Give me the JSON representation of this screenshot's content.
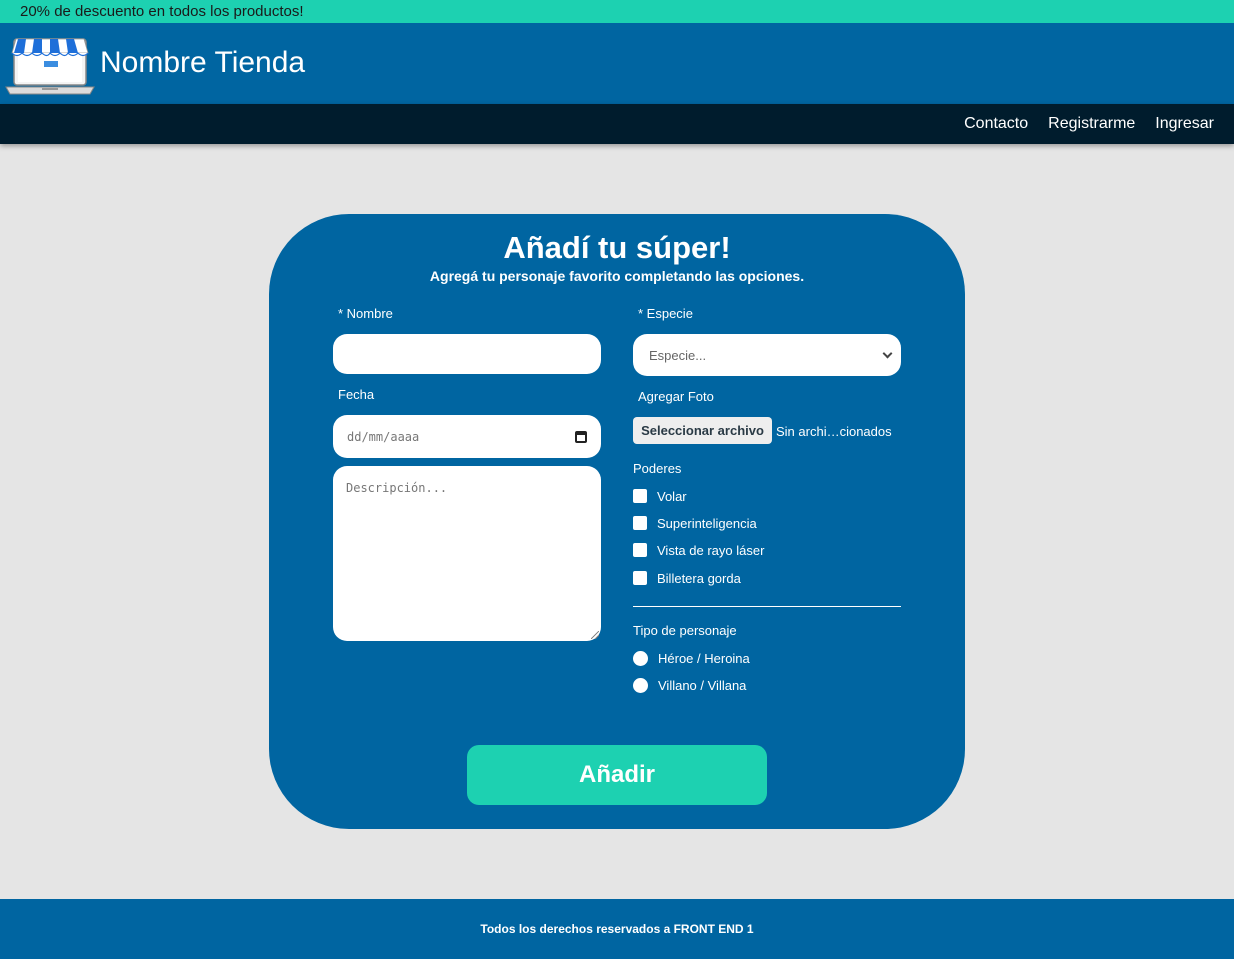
{
  "promo": {
    "text": "20% de descuento en todos los productos!"
  },
  "header": {
    "store_name": "Nombre Tienda",
    "logo_icon": "storefront-laptop-icon"
  },
  "nav": {
    "items": [
      "Contacto",
      "Registrarme",
      "Ingresar"
    ]
  },
  "form": {
    "title": "Añadí tu súper!",
    "subtitle": "Agregá tu personaje favorito completando las opciones.",
    "name_label": "* Nombre",
    "name_value": "",
    "date_label": "Fecha",
    "date_placeholder": "dd/mm/aaaa",
    "description_placeholder": "Descripción...",
    "species_label": "* Especie",
    "species_selected": "Especie...",
    "photo_label": "Agregar Foto",
    "file_button": "Seleccionar archivo",
    "file_status": "Sin archi…cionados",
    "powers_label": "Poderes",
    "powers": [
      "Volar",
      "Superinteligencia",
      "Vista de rayo láser",
      "Billetera gorda"
    ],
    "type_label": "Tipo de personaje",
    "types": [
      "Héroe / Heroina",
      "Villano / Villana"
    ],
    "submit_label": "Añadir"
  },
  "footer": {
    "text": "Todos los derechos reservados a FRONT END 1"
  },
  "colors": {
    "primary": "#0065a1",
    "accent": "#1dd1b1",
    "nav_bg": "#001c2d",
    "page_bg": "#e5e5e5"
  }
}
